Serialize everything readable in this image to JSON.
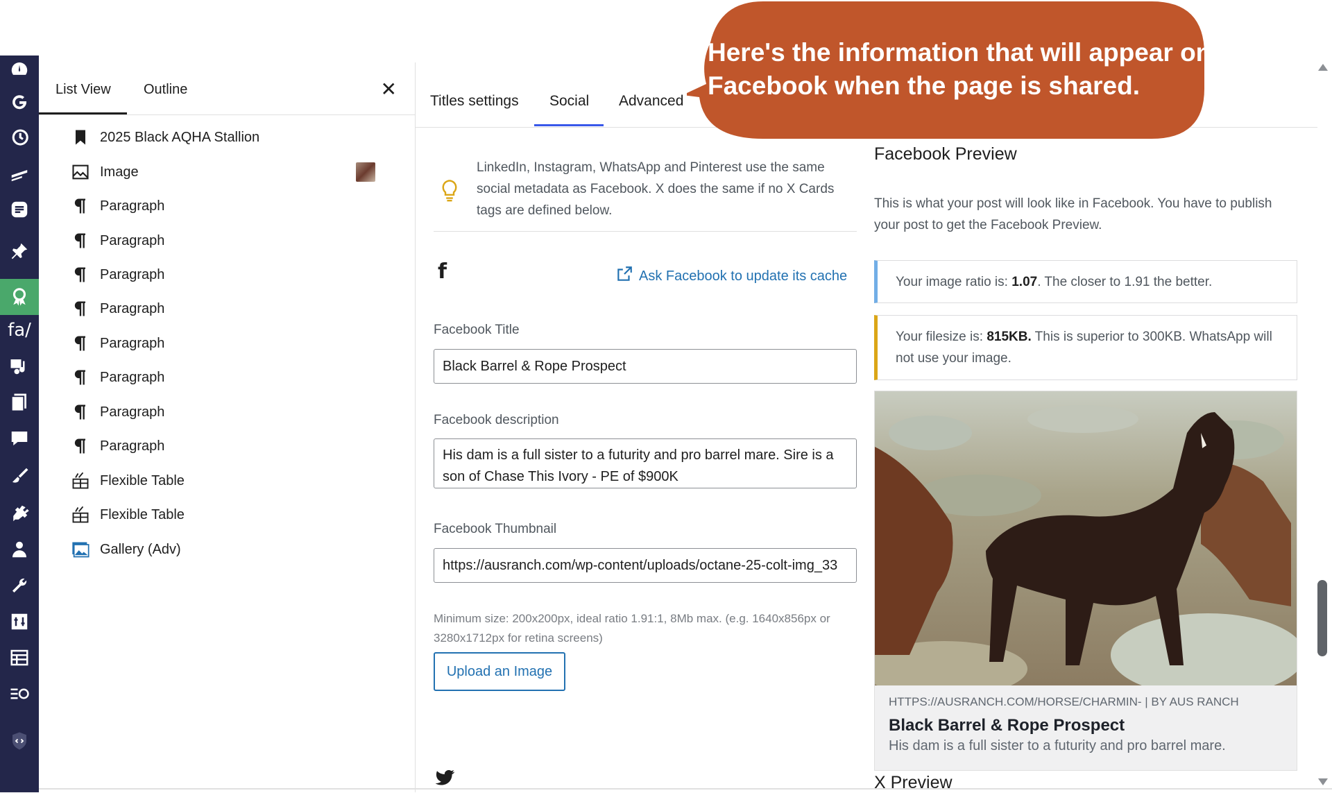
{
  "callout": {
    "text": "Here's the information that will appear on Facebook when the page is shared."
  },
  "list_panel": {
    "tabs": [
      "List View",
      "Outline"
    ],
    "close_icon": "close-icon",
    "items": [
      {
        "label": "2025 Black AQHA Stallion",
        "icon": "bookmark-icon"
      },
      {
        "label": "Image",
        "icon": "image-icon"
      },
      {
        "label": "Paragraph",
        "icon": "paragraph-icon"
      },
      {
        "label": "Paragraph",
        "icon": "paragraph-icon"
      },
      {
        "label": "Paragraph",
        "icon": "paragraph-icon"
      },
      {
        "label": "Paragraph",
        "icon": "paragraph-icon"
      },
      {
        "label": "Paragraph",
        "icon": "paragraph-icon"
      },
      {
        "label": "Paragraph",
        "icon": "paragraph-icon"
      },
      {
        "label": "Paragraph",
        "icon": "paragraph-icon"
      },
      {
        "label": "Paragraph",
        "icon": "paragraph-icon"
      },
      {
        "label": "Flexible Table",
        "icon": "table-icon"
      },
      {
        "label": "Flexible Table",
        "icon": "table-icon"
      },
      {
        "label": "Gallery (Adv)",
        "icon": "gallery-icon"
      }
    ]
  },
  "settings": {
    "tabs": [
      "Titles settings",
      "Social",
      "Advanced"
    ],
    "active_tab": "Social",
    "tip": "LinkedIn, Instagram, WhatsApp and Pinterest use the same social metadata as Facebook. X does the same if no X Cards tags are defined below.",
    "cache_link": "Ask Facebook to update its cache",
    "fb_title_label": "Facebook Title",
    "fb_title_value": "Black Barrel & Rope Prospect",
    "fb_desc_label": "Facebook description",
    "fb_desc_value": "His dam is a full sister to a futurity and pro barrel mare. Sire is a son of Chase This Ivory - PE of $900K",
    "fb_thumb_label": "Facebook Thumbnail",
    "fb_thumb_value": "https://ausranch.com/wp-content/uploads/octane-25-colt-img_33",
    "thumb_help": "Minimum size: 200x200px, ideal ratio 1.91:1, 8Mb max. (e.g. 1640x856px or 3280x1712px for retina screens)",
    "upload_button": "Upload an Image"
  },
  "preview": {
    "title": "Facebook Preview",
    "description": "This is what your post will look like in Facebook. You have to publish your post to get the Facebook Preview.",
    "ratio_prefix": "Your image ratio is: ",
    "ratio_value": "1.07",
    "ratio_suffix": ". The closer to 1.91 the better.",
    "size_prefix": "Your filesize is: ",
    "size_value": "815KB.",
    "size_suffix": " This is superior to 300KB. WhatsApp will not use your image.",
    "card_url": "HTTPS://AUSRANCH.COM/HORSE/CHARMIN- | BY AUS RANCH",
    "card_title": "Black Barrel & Rope Prospect",
    "card_desc": "His dam is a full sister to a futurity and pro barrel mare.",
    "x_preview_title": "X Preview"
  },
  "colors": {
    "accent": "#3858e9",
    "link": "#2271b1",
    "callout": "#c0562b",
    "admin_bar": "#23264a"
  }
}
